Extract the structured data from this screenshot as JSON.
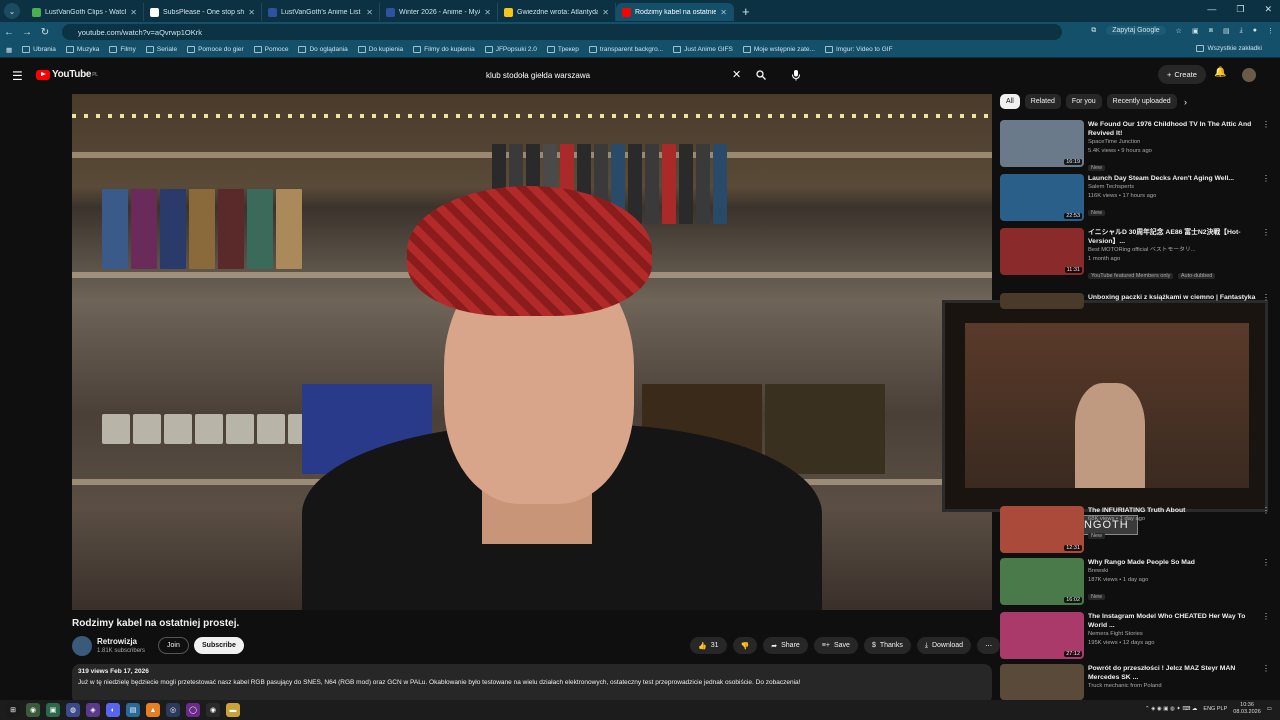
{
  "browser": {
    "tabs": [
      {
        "title": "LustVanGoth Clips - Watch Live",
        "color": "#4caf50"
      },
      {
        "title": "SubsPlease - One stop shop fo",
        "color": "#ffffff"
      },
      {
        "title": "LustVanGoth's Anime List - My",
        "color": "#2e51a2"
      },
      {
        "title": "Winter 2026 - Anime - MyAnim",
        "color": "#2e51a2"
      },
      {
        "title": "Gwiezdne wrota: Atlantyda / St",
        "color": "#f5c518"
      },
      {
        "title": "Rodzimy kabel na ostatniej",
        "color": "#ff0000"
      }
    ],
    "url": "youtube.com/watch?v=aQvrwp1OKrk",
    "google_button": "Zapytaj Google",
    "bookmarks": [
      "Ubrania",
      "Muzyka",
      "Filmy",
      "Seriale",
      "Pomoce do gier",
      "Pomoce",
      "Do oglądania",
      "Do kupienia",
      "Filmy do kupienia",
      "JFPopsuki 2.0",
      "Трекер",
      "transparent backgro...",
      "Just Anime GIFS",
      "Moje wstępnie zate...",
      "Imgur: Video to GIF"
    ],
    "all_bookmarks": "Wszystkie zakładki"
  },
  "youtube": {
    "logo": "YouTube",
    "country": "PL",
    "search_query": "klub stodoła giełda warszawa",
    "create_label": "Create"
  },
  "video": {
    "title": "Rodzimy kabel na ostatniej prostej.",
    "channel": "Retrowizja",
    "subscribers": "1.81K subscribers",
    "join": "Join",
    "subscribe": "Subscribe",
    "likes": "31",
    "share": "Share",
    "save": "Save",
    "thanks": "Thanks",
    "download": "Download",
    "views_date": "319 views  Feb 17, 2026",
    "description": "Już w tę niedzielę będziecie mogli przetestować nasz kabel RGB pasujący do SNES, N64 (RGB mod) oraz GCN w PALu. Okablowanie było testowane na wielu działach elektronowych, ostateczny test przeprowadzicie jednak osobiście. Do zobaczenia!",
    "overlay_name": "LUSTVANGOTH"
  },
  "chips": [
    "All",
    "Related",
    "For you",
    "Recently uploaded"
  ],
  "recommendations": [
    {
      "title": "We Found Our 1976 Childhood TV In The Attic And Revived It!",
      "channel": "SpaceTime Junction",
      "meta": "5.4K views • 9 hours ago",
      "badge": "New",
      "duration": "16:19",
      "color": "#6a7a8a"
    },
    {
      "title": "Launch Day Steam Decks Aren't Aging Well...",
      "channel": "Salem Techsperts",
      "meta": "116K views • 17 hours ago",
      "badge": "New",
      "duration": "22:53",
      "color": "#2a5f8a"
    },
    {
      "title": "イニシャルD 30周年記念 AE86 富士N2決戦【Hot-Version】...",
      "channel": "Best MOTORing official ベストモータリ...",
      "meta": "1 month ago",
      "badge": "YouTube featured  Members only",
      "extra": "Auto-dubbed",
      "duration": "11:31",
      "color": "#8a2a2a"
    },
    {
      "title": "Unboxing paczki z książkami w ciemno | Fantastyka",
      "channel": "",
      "meta": "",
      "badge": "",
      "duration": "",
      "color": "#4a3a2a"
    },
    {
      "title": "The INFURIATING Truth About",
      "channel": "",
      "meta": "68K views • 1 day ago",
      "badge": "New",
      "duration": "12:31",
      "color": "#aa4a3a"
    },
    {
      "title": "Why Rango Made People So Mad",
      "channel": "Brewski",
      "meta": "187K views • 1 day ago",
      "badge": "New",
      "duration": "16:02",
      "color": "#4a7a4a"
    },
    {
      "title": "The Instagram Model Who CHEATED Her Way To World ...",
      "channel": "Nemera Fight Stories",
      "meta": "195K views • 12 days ago",
      "badge": "",
      "duration": "27:12",
      "color": "#aa3a6a"
    },
    {
      "title": "Powrót do przeszłości ! Jelcz MAZ Steyr MAN Mercedes SK ...",
      "channel": "Truck mechanic from Poland",
      "meta": "343K views • 3 years ago",
      "badge": "",
      "duration": "",
      "color": "#5a4a3a"
    }
  ],
  "taskbar": {
    "lang": "ENG PLP",
    "time": "10:36",
    "date": "08.03.2026"
  }
}
